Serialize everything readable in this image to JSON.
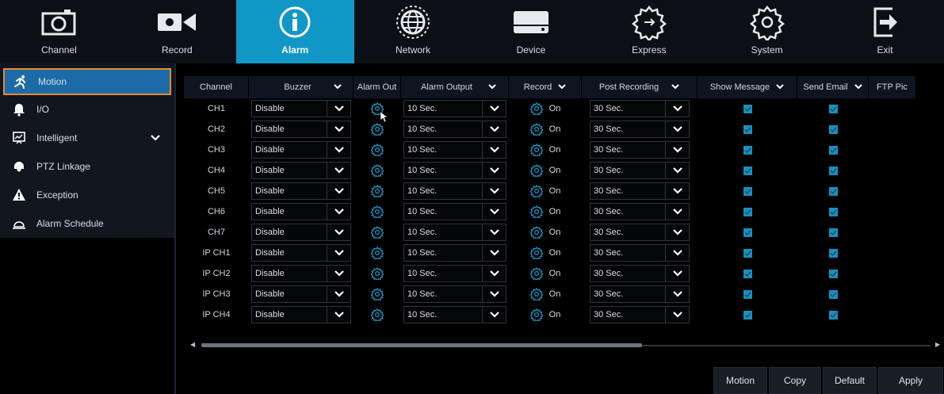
{
  "nav": [
    {
      "label": "Channel",
      "icon": "camera-icon"
    },
    {
      "label": "Record",
      "icon": "video-camera-icon"
    },
    {
      "label": "Alarm",
      "icon": "info-icon",
      "active": true
    },
    {
      "label": "Network",
      "icon": "globe-icon"
    },
    {
      "label": "Device",
      "icon": "hard-drive-icon"
    },
    {
      "label": "Express",
      "icon": "express-gear-icon"
    },
    {
      "label": "System",
      "icon": "gear-icon"
    },
    {
      "label": "Exit",
      "icon": "exit-icon"
    }
  ],
  "sidebar": [
    {
      "label": "Motion",
      "icon": "running-man-icon",
      "active": true
    },
    {
      "label": "I/O",
      "icon": "bell-icon"
    },
    {
      "label": "Intelligent",
      "icon": "monitor-chart-icon",
      "has_dropdown": true
    },
    {
      "label": "PTZ Linkage",
      "icon": "ptz-camera-icon"
    },
    {
      "label": "Exception",
      "icon": "warning-icon"
    },
    {
      "label": "Alarm Schedule",
      "icon": "schedule-icon"
    }
  ],
  "table": {
    "headers": {
      "channel": "Channel",
      "buzzer": "Buzzer",
      "alarm_out": "Alarm Out",
      "alarm_output": "Alarm Output",
      "record": "Record",
      "post_recording": "Post Recording",
      "show_message": "Show Message",
      "send_email": "Send Email",
      "ftp": "FTP Pic"
    },
    "rows": [
      {
        "channel": "CH1",
        "buzzer": "Disable",
        "alarm_output": "10 Sec.",
        "record": "On",
        "post_recording": "30 Sec.",
        "show_message": true,
        "send_email": true
      },
      {
        "channel": "CH2",
        "buzzer": "Disable",
        "alarm_output": "10 Sec.",
        "record": "On",
        "post_recording": "30 Sec.",
        "show_message": true,
        "send_email": true
      },
      {
        "channel": "CH3",
        "buzzer": "Disable",
        "alarm_output": "10 Sec.",
        "record": "On",
        "post_recording": "30 Sec.",
        "show_message": true,
        "send_email": true
      },
      {
        "channel": "CH4",
        "buzzer": "Disable",
        "alarm_output": "10 Sec.",
        "record": "On",
        "post_recording": "30 Sec.",
        "show_message": true,
        "send_email": true
      },
      {
        "channel": "CH5",
        "buzzer": "Disable",
        "alarm_output": "10 Sec.",
        "record": "On",
        "post_recording": "30 Sec.",
        "show_message": true,
        "send_email": true
      },
      {
        "channel": "CH6",
        "buzzer": "Disable",
        "alarm_output": "10 Sec.",
        "record": "On",
        "post_recording": "30 Sec.",
        "show_message": true,
        "send_email": true
      },
      {
        "channel": "CH7",
        "buzzer": "Disable",
        "alarm_output": "10 Sec.",
        "record": "On",
        "post_recording": "30 Sec.",
        "show_message": true,
        "send_email": true
      },
      {
        "channel": "IP CH1",
        "buzzer": "Disable",
        "alarm_output": "10 Sec.",
        "record": "On",
        "post_recording": "30 Sec.",
        "show_message": true,
        "send_email": true
      },
      {
        "channel": "IP CH2",
        "buzzer": "Disable",
        "alarm_output": "10 Sec.",
        "record": "On",
        "post_recording": "30 Sec.",
        "show_message": true,
        "send_email": true
      },
      {
        "channel": "IP CH3",
        "buzzer": "Disable",
        "alarm_output": "10 Sec.",
        "record": "On",
        "post_recording": "30 Sec.",
        "show_message": true,
        "send_email": true
      },
      {
        "channel": "IP CH4",
        "buzzer": "Disable",
        "alarm_output": "10 Sec.",
        "record": "On",
        "post_recording": "30 Sec.",
        "show_message": true,
        "send_email": true
      }
    ]
  },
  "buttons": {
    "motion": "Motion",
    "copy": "Copy",
    "default": "Default",
    "apply": "Apply"
  },
  "colors": {
    "accent": "#1197c5",
    "active_sidebar": "#1c6aa8",
    "highlight_border": "#e88a2e",
    "checkbox": "#1a8fbe"
  }
}
